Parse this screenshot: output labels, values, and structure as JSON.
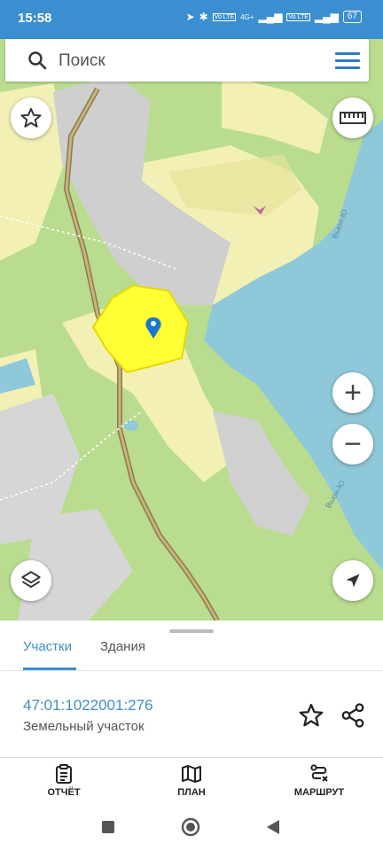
{
  "status_bar": {
    "time": "15:58",
    "signal_label": "4G+",
    "volte_1": "Vo LTE",
    "volte_2": "Vo LTE",
    "battery": "67"
  },
  "search": {
    "placeholder": "Поиск"
  },
  "map": {
    "labels": [
      "Вьюн-Ю",
      "Вьюн-Ю"
    ],
    "colors": {
      "forest": "#b9dc8f",
      "field": "#f2f0b5",
      "water": "#8fc8d8",
      "urban": "#cfcfcf",
      "selection": "#ffff33",
      "road": "#a08c5a"
    }
  },
  "map_controls": {
    "favorites_icon": "star-outline-icon",
    "ruler_icon": "ruler-icon",
    "zoom_in_label": "+",
    "zoom_out_label": "−",
    "layers_icon": "layers-icon",
    "locate_icon": "navigation-arrow-icon"
  },
  "sheet": {
    "tabs": [
      {
        "label": "Участки",
        "active": true
      },
      {
        "label": "Здания",
        "active": false
      }
    ],
    "parcel": {
      "cadastral_number": "47:01:1022001:276",
      "type": "Земельный участок"
    }
  },
  "bottom_nav": {
    "items": [
      {
        "label": "ОТЧЁТ",
        "icon": "clipboard-icon"
      },
      {
        "label": "ПЛАН",
        "icon": "map-icon"
      },
      {
        "label": "МАРШРУТ",
        "icon": "route-icon"
      }
    ]
  },
  "accent_color": "#3b8fd0"
}
